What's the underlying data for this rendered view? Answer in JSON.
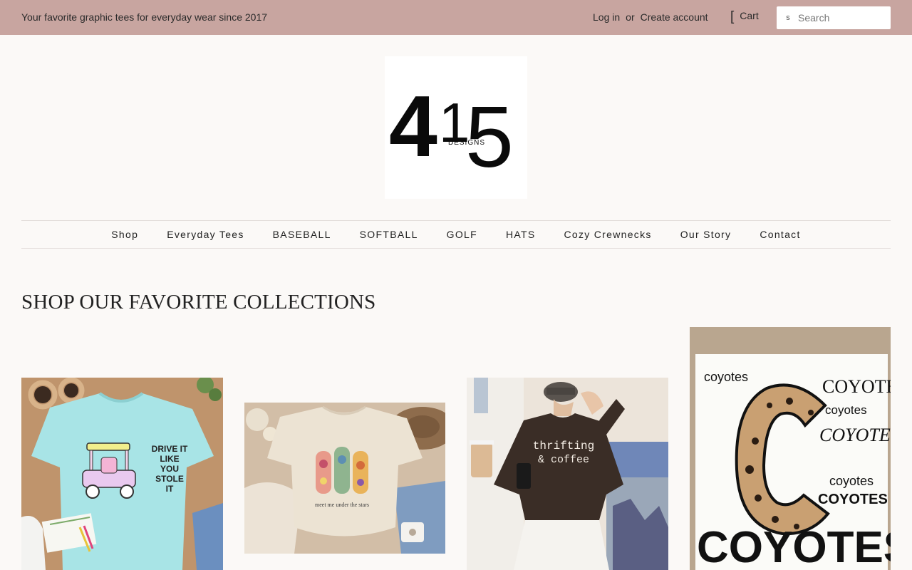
{
  "topbar": {
    "tagline": "Your favorite graphic tees for everyday wear since 2017",
    "login_label": "Log in",
    "or_label": "or",
    "create_account_label": "Create account",
    "cart_icon_glyph": "[",
    "cart_label": "Cart",
    "search_icon_glyph": "s",
    "search_placeholder": "Search"
  },
  "logo": {
    "number_left": "4",
    "number_mid": "1",
    "number_right": "5",
    "sub": "DESIGNS"
  },
  "nav": {
    "items": [
      "Shop",
      "Everyday Tees",
      "BASEBALL",
      "SOFTBALL",
      "GOLF",
      "HATS",
      "Cozy Crewnecks",
      "Our Story",
      "Contact"
    ]
  },
  "main": {
    "section_title": "SHOP OUR FAVORITE COLLECTIONS",
    "collections": [
      {
        "image_name": "golf-tee-collection-image",
        "shirt_text": [
          "DRIVE IT",
          "LIKE",
          "YOU",
          "STOLE",
          "IT"
        ]
      },
      {
        "image_name": "everyday-tee-collection-image",
        "shirt_text": [
          "meet me under the stars"
        ]
      },
      {
        "image_name": "crewneck-collection-image",
        "shirt_text": [
          "thrifting",
          "& coffee"
        ]
      },
      {
        "image_name": "coyotes-collection-image",
        "shirt_text": [
          "coyotes",
          "COYOTES",
          "coyotes",
          "COYOTES",
          "coyotes",
          "COYOTES",
          "C"
        ]
      }
    ]
  },
  "colors": {
    "topbar_bg": "#c8a5a0",
    "page_bg": "#fbf9f7",
    "text": "#222222"
  }
}
